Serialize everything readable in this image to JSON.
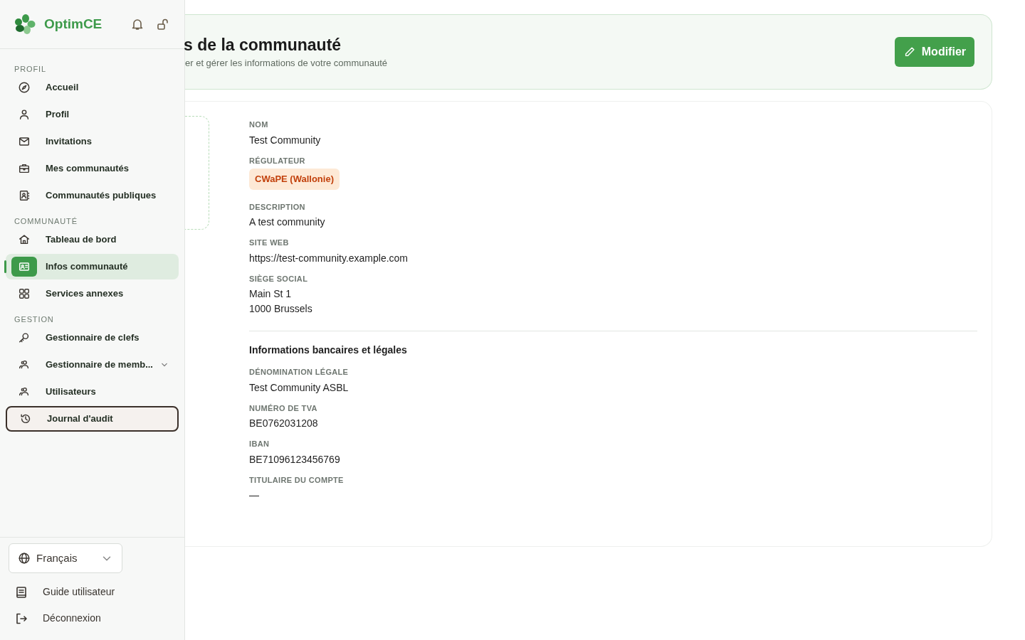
{
  "sidebar": {
    "brand": "OptimCE",
    "sections": [
      {
        "label": "PROFIL",
        "items": [
          {
            "kind": "link",
            "label": "Accueil",
            "selected": false,
            "focused": false
          },
          {
            "kind": "link",
            "label": "Profil",
            "selected": false,
            "focused": false
          },
          {
            "kind": "link",
            "label": "Invitations",
            "selected": false,
            "focused": false
          },
          {
            "kind": "link",
            "label": "Mes communautés",
            "selected": false,
            "focused": false
          },
          {
            "kind": "link",
            "label": "Communautés publiques",
            "selected": false,
            "focused": false
          }
        ]
      },
      {
        "label": "COMMUNAUTÉ",
        "items": [
          {
            "kind": "link",
            "label": "Tableau de bord",
            "selected": false,
            "focused": false
          },
          {
            "kind": "link",
            "label": "Infos communauté",
            "selected": true,
            "focused": false
          },
          {
            "kind": "link",
            "label": "Services annexes",
            "selected": false,
            "focused": false
          }
        ]
      },
      {
        "label": "GESTION",
        "items": [
          {
            "kind": "link",
            "label": "Gestionnaire de clefs",
            "selected": false,
            "focused": false
          },
          {
            "kind": "group",
            "label": "Gestionnaire de memb...",
            "selected": false,
            "focused": false,
            "expanded": false
          },
          {
            "kind": "link",
            "label": "Utilisateurs",
            "selected": false,
            "focused": false
          },
          {
            "kind": "link",
            "label": "Journal d'audit",
            "selected": false,
            "focused": true
          }
        ]
      }
    ],
    "language": "Français",
    "footer_links": [
      "Guide utilisateur",
      "Déconnexion"
    ]
  },
  "header": {
    "title": "s de la communauté",
    "subtitle": "er et gérer les informations de votre communauté",
    "button": "Modifier"
  },
  "details": {
    "fields": [
      {
        "kind": "text",
        "label": "NOM",
        "value": "Test Community"
      },
      {
        "kind": "badge",
        "label": "RÉGULATEUR",
        "value": "CWaPE (Wallonie)"
      },
      {
        "kind": "text",
        "label": "DESCRIPTION",
        "value": "A test community"
      },
      {
        "kind": "text",
        "label": "SITE WEB",
        "value": "https://test-community.example.com"
      },
      {
        "kind": "lines",
        "label": "SIÈGE SOCIAL",
        "lines": [
          "Main St 1",
          "1000 Brussels"
        ]
      }
    ],
    "bank_section": {
      "title": "Informations bancaires et légales",
      "fields": [
        {
          "kind": "text",
          "label": "DÉNOMINATION LÉGALE",
          "value": "Test Community ASBL"
        },
        {
          "kind": "text",
          "label": "NUMÉRO DE TVA",
          "value": "BE0762031208"
        },
        {
          "kind": "text",
          "label": "IBAN",
          "value": "BE71096123456769"
        },
        {
          "kind": "text",
          "label": "TITULAIRE DU COMPTE",
          "value": "—"
        }
      ]
    }
  }
}
